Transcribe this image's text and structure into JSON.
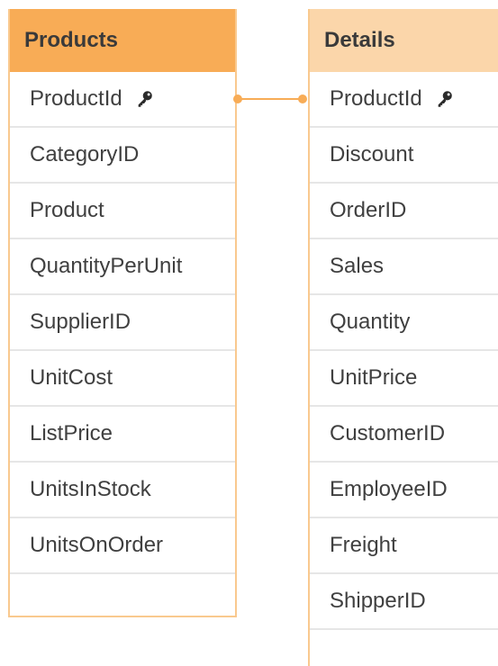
{
  "products_table": {
    "title": "Products",
    "fields": [
      {
        "name": "ProductId",
        "key": true
      },
      {
        "name": "CategoryID",
        "key": false
      },
      {
        "name": "Product",
        "key": false
      },
      {
        "name": "QuantityPerUnit",
        "key": false
      },
      {
        "name": "SupplierID",
        "key": false
      },
      {
        "name": "UnitCost",
        "key": false
      },
      {
        "name": "ListPrice",
        "key": false
      },
      {
        "name": "UnitsInStock",
        "key": false
      },
      {
        "name": "UnitsOnOrder",
        "key": false
      }
    ]
  },
  "details_table": {
    "title": "Details",
    "fields": [
      {
        "name": "ProductId",
        "key": true
      },
      {
        "name": "Discount",
        "key": false
      },
      {
        "name": "OrderID",
        "key": false
      },
      {
        "name": "Sales",
        "key": false
      },
      {
        "name": "Quantity",
        "key": false
      },
      {
        "name": "UnitPrice",
        "key": false
      },
      {
        "name": "CustomerID",
        "key": false
      },
      {
        "name": "EmployeeID",
        "key": false
      },
      {
        "name": "Freight",
        "key": false
      },
      {
        "name": "ShipperID",
        "key": false
      }
    ]
  },
  "connector": {
    "color": "#f8ac56",
    "from_field": "ProductId",
    "to_field": "ProductId"
  },
  "colors": {
    "products_header": "#f8ac56",
    "details_header": "#fbd6aa",
    "table_border": "#f9c98f",
    "row_divider": "#e6e6e6",
    "text": "#404040"
  }
}
